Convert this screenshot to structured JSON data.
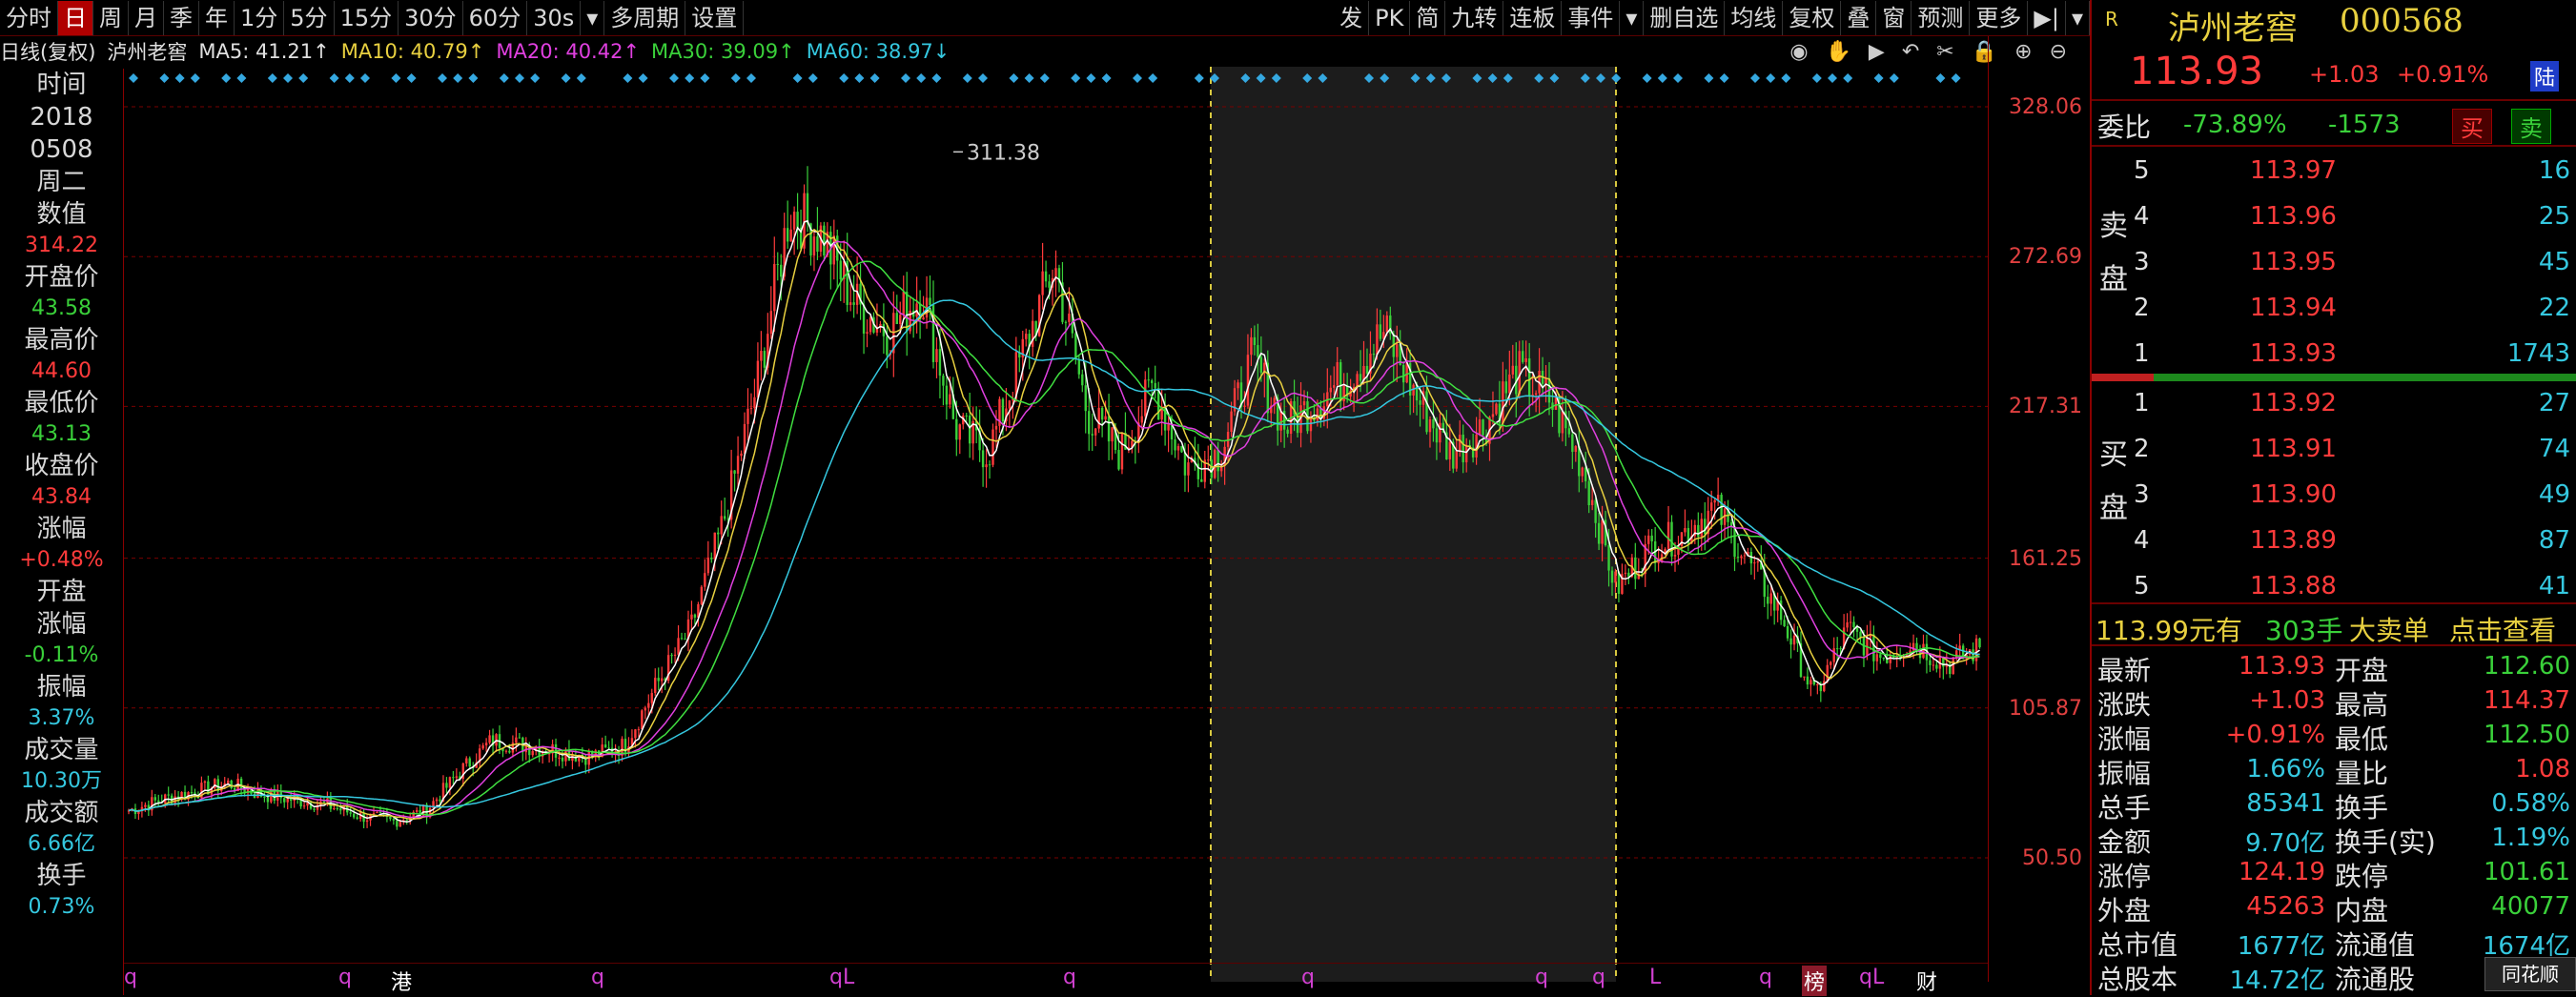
{
  "toolbar": {
    "items": [
      "分时",
      "日",
      "周",
      "月",
      "季",
      "年",
      "1分",
      "5分",
      "15分",
      "30分",
      "60分",
      "30s",
      "▾",
      "多周期",
      "设置"
    ],
    "selected": 1,
    "right_items": [
      "发",
      "PK",
      "简",
      "九转",
      "连板",
      "事件",
      "▾",
      "删自选",
      "均线",
      "复权",
      "叠",
      "窗",
      "预测",
      "更多",
      "▶|",
      "▾"
    ]
  },
  "info": {
    "period": "日线(复权)",
    "name": "泸州老窖",
    "ma5": "MA5: 41.21↑",
    "ma10": "MA10: 40.79↑",
    "ma20": "MA20: 40.42↑",
    "ma30": "MA30: 39.09↑",
    "ma60": "MA60: 38.97↓"
  },
  "info_icons": [
    "eye-icon",
    "hand-icon",
    "play-icon",
    "undo-icon",
    "scissors-icon",
    "lock-icon",
    "zoom-in-icon",
    "zoom-out-icon"
  ],
  "colors": {
    "up": "#ff3b3b",
    "down": "#3ad03a",
    "ma5": "#ffffff",
    "ma10": "#e8d040",
    "ma20": "#e040e0",
    "ma30": "#40e040",
    "ma60": "#35c8e0",
    "highlight": "#1c1c1c"
  },
  "axis_ticks": [
    "328.06",
    "272.69",
    "217.31",
    "161.25",
    "105.87",
    "50.50"
  ],
  "peak_label": "311.38",
  "left_panel": [
    {
      "label": "时间",
      "value": ""
    },
    {
      "label": "2018",
      "value": ""
    },
    {
      "label": "0508",
      "value": ""
    },
    {
      "label": "周二",
      "value": ""
    },
    {
      "label": "数值",
      "value": "314.22",
      "color": "red"
    },
    {
      "label": "开盘价",
      "value": "43.58",
      "color": "green"
    },
    {
      "label": "最高价",
      "value": "44.60",
      "color": "red"
    },
    {
      "label": "最低价",
      "value": "43.13",
      "color": "green"
    },
    {
      "label": "收盘价",
      "value": "43.84",
      "color": "red"
    },
    {
      "label": "涨幅",
      "value": "+0.48%",
      "color": "red"
    },
    {
      "label": "开盘",
      "value": ""
    },
    {
      "label": "涨幅",
      "value": "-0.11%",
      "color": "green"
    },
    {
      "label": "振幅",
      "value": "3.37%",
      "color": "cyan"
    },
    {
      "label": "成交量",
      "value": "10.30万",
      "color": "cyan"
    },
    {
      "label": "成交额",
      "value": "6.66亿",
      "color": "cyan"
    },
    {
      "label": "换手",
      "value": "0.73%",
      "color": "cyan"
    }
  ],
  "bottom_markers": [
    "q",
    "q",
    "港",
    "q",
    "qL",
    "q",
    "q",
    "q",
    "q",
    "L",
    "q",
    "榜",
    "qL",
    "财"
  ],
  "chart_data": {
    "type": "candlestick",
    "title": "泸州老窖 000568 日线(复权)",
    "ylim": [
      50.5,
      328.06
    ],
    "highlighted_range": "period shaded",
    "peak": 311.38,
    "series": [
      {
        "name": "close",
        "values": [
          68,
          72,
          75,
          78,
          74,
          72,
          70,
          66,
          64,
          68,
          82,
          94,
          92,
          90,
          88,
          92,
          115,
          135,
          175,
          225,
          290,
          280,
          255,
          245,
          260,
          210,
          200,
          235,
          270,
          215,
          200,
          225,
          195,
          200,
          235,
          210,
          220,
          230,
          245,
          220,
          200,
          210,
          230,
          220,
          195,
          150,
          165,
          170,
          180,
          160,
          140,
          110,
          135,
          125,
          130,
          122,
          128
        ]
      }
    ]
  },
  "stock": {
    "name": "泸州老窖",
    "code": "000568",
    "price": "113.93",
    "change": "+1.03",
    "pct": "+0.91%",
    "market": "陆"
  },
  "weibi": {
    "label": "委比",
    "pct": "-73.89%",
    "diff": "-1573",
    "buy": "买",
    "sell": "卖"
  },
  "sell_side_label": "卖盘",
  "buy_side_label": "买盘",
  "asks": [
    {
      "n": "5",
      "p": "113.97",
      "v": "16"
    },
    {
      "n": "4",
      "p": "113.96",
      "v": "25"
    },
    {
      "n": "3",
      "p": "113.95",
      "v": "45"
    },
    {
      "n": "2",
      "p": "113.94",
      "v": "22"
    },
    {
      "n": "1",
      "p": "113.93",
      "v": "1743"
    }
  ],
  "bids": [
    {
      "n": "1",
      "p": "113.92",
      "v": "27"
    },
    {
      "n": "2",
      "p": "113.91",
      "v": "74"
    },
    {
      "n": "3",
      "p": "113.90",
      "v": "49"
    },
    {
      "n": "4",
      "p": "113.89",
      "v": "87"
    },
    {
      "n": "5",
      "p": "113.88",
      "v": "41"
    }
  ],
  "bigorder": {
    "text1": "113.99元有",
    "text2": "303手",
    "text3": "大卖单",
    "text4": "点击查看"
  },
  "stats": [
    [
      "最新",
      "113.93",
      "red",
      "开盘",
      "112.60",
      "green"
    ],
    [
      "涨跌",
      "+1.03",
      "red",
      "最高",
      "114.37",
      "red"
    ],
    [
      "涨幅",
      "+0.91%",
      "red",
      "最低",
      "112.50",
      "green"
    ],
    [
      "振幅",
      "1.66%",
      "cyan",
      "量比",
      "1.08",
      "red"
    ],
    [
      "总手",
      "85341",
      "cyan",
      "换手",
      "0.58%",
      "cyan"
    ],
    [
      "金额",
      "9.70亿",
      "cyan",
      "换手(实)",
      "1.19%",
      "cyan"
    ],
    [
      "涨停",
      "124.19",
      "red",
      "跌停",
      "101.61",
      "green"
    ],
    [
      "外盘",
      "45263",
      "red",
      "内盘",
      "40077",
      "green"
    ],
    [
      "总市值",
      "1677亿",
      "cyan",
      "流通值",
      "1674亿",
      "cyan"
    ],
    [
      "总股本",
      "14.72亿",
      "cyan",
      "流通股",
      "",
      ""
    ]
  ],
  "brand": "同花顺"
}
